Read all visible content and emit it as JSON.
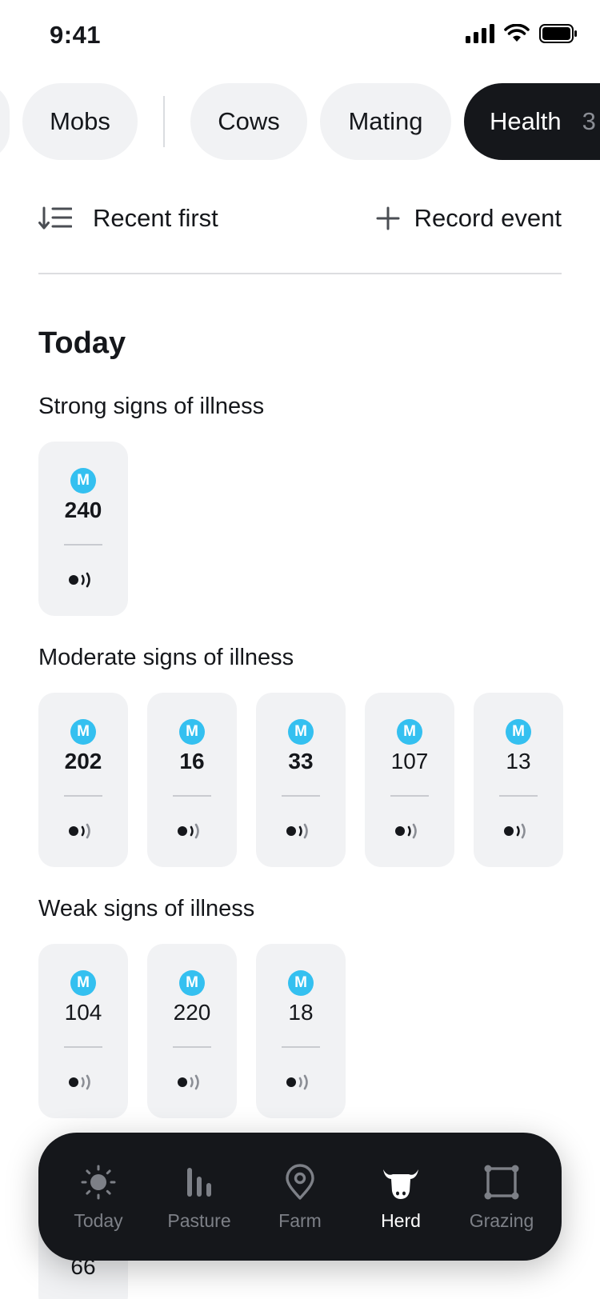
{
  "status_bar": {
    "time": "9:41"
  },
  "filters": {
    "items": [
      {
        "label": "Mobs"
      },
      {
        "label": "Cows"
      },
      {
        "label": "Mating"
      },
      {
        "label": "Health",
        "count": "3"
      }
    ]
  },
  "toolbar": {
    "sort_label": "Recent first",
    "record_label": "Record event"
  },
  "section": {
    "title": "Today"
  },
  "groups": [
    {
      "title": "Strong signs of illness",
      "cards": [
        {
          "badge": "M",
          "number": "240",
          "bold": true
        }
      ]
    },
    {
      "title": "Moderate signs of illness",
      "cards": [
        {
          "badge": "M",
          "number": "202",
          "bold": true
        },
        {
          "badge": "M",
          "number": "16",
          "bold": true
        },
        {
          "badge": "M",
          "number": "33",
          "bold": true
        },
        {
          "badge": "M",
          "number": "107",
          "bold": false
        },
        {
          "badge": "M",
          "number": "13",
          "bold": false
        }
      ]
    },
    {
      "title": "Weak signs of illness",
      "cards": [
        {
          "badge": "M",
          "number": "104",
          "bold": false
        },
        {
          "badge": "M",
          "number": "220",
          "bold": false
        },
        {
          "badge": "M",
          "number": "18",
          "bold": false
        }
      ]
    }
  ],
  "partial_card": {
    "number": "66"
  },
  "nav": {
    "items": [
      {
        "label": "Today",
        "icon": "sun-icon"
      },
      {
        "label": "Pasture",
        "icon": "bars-icon"
      },
      {
        "label": "Farm",
        "icon": "map-pin-icon"
      },
      {
        "label": "Herd",
        "icon": "cow-icon",
        "active": true
      },
      {
        "label": "Grazing",
        "icon": "square-nodes-icon"
      }
    ]
  },
  "colors": {
    "badge": "#34c0f0",
    "active_pill": "#15171b",
    "nav_bg": "#15171b"
  }
}
